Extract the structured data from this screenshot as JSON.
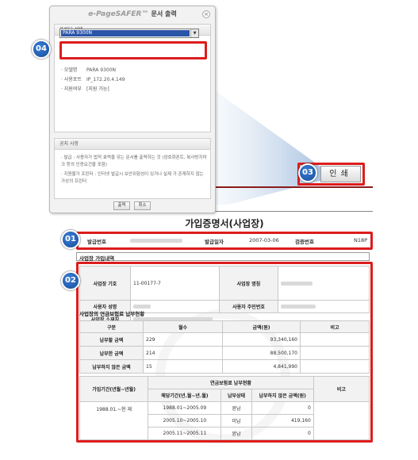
{
  "dialog": {
    "brand": "e-PageSAFER™",
    "title": "문서 출력",
    "close": "×",
    "printer_section": "프린터 선택",
    "printer_selected": "PARA 9300N",
    "info": [
      {
        "key": "· 모델명",
        "value": "PARA 9300N"
      },
      {
        "key": "· 사용포트",
        "value": "IP_172.20.4.149"
      },
      {
        "key": "· 지원여부",
        "value": "[지원 가능]"
      }
    ],
    "notice_section": "공지 사항",
    "notice_1": "· 발급 : 사용자가 법적 효력을 갖는 문서를 출력하는 것 (암호화폰트, 복사방지마크 등의 인증요건을 포함)",
    "notice_2": "· 지원불가 프린터 : 인터넷 발급시 보안위험성이 있거나 실제 가 존재하지 않는 가상의 프린터",
    "ok_button": "출력",
    "cancel_button": "취소"
  },
  "print_button": "인쇄",
  "badges": {
    "b1": "01",
    "b2": "02",
    "b3": "03",
    "b4": "04"
  },
  "document": {
    "title": "가입증명서(사업장)",
    "meta": {
      "issue_no_label": "발급번호",
      "issue_date_label": "발급일자",
      "issue_date": "2007-03-06",
      "verify_no_label": "검증번호",
      "verify_no": "N18P"
    },
    "section_membership": "사업장 가입내역",
    "membership": {
      "code_label": "사업장 기호",
      "code_value": "11-00177-7",
      "name_label": "사업장 명칭",
      "owner_label": "사용자 성명",
      "owner_id_label": "사용자 주민번호",
      "address_label": "사업장 소재지"
    },
    "section_payment": "사업장의 연금보험료 납부현황",
    "payment_headers": [
      "구분",
      "월수",
      "금액(원)",
      "비고"
    ],
    "payment_rows": [
      {
        "label": "납부할 금액",
        "months": "229",
        "amount": "93,340,160",
        "note": ""
      },
      {
        "label": "납부한 금액",
        "months": "214",
        "amount": "88,500,170",
        "note": ""
      },
      {
        "label": "납부하지 않은 금액",
        "months": "15",
        "amount": "4,841,990",
        "note": ""
      }
    ],
    "period_table": {
      "join_period_header": "가입기간(년월~년월)",
      "group_header": "연금보험료 납부현황",
      "col_period": "해당기간(년.월~년.월)",
      "col_status": "납부상태",
      "col_unpaid": "납부하지 않은 금액(원)",
      "col_note": "비고",
      "join_period": "1988.01.~현 재",
      "rows": [
        {
          "period": "1988.01~2005.09",
          "status": "완납",
          "unpaid": "0"
        },
        {
          "period": "2005.10~2005.10",
          "status": "미납",
          "unpaid": "419,160"
        },
        {
          "period": "2005.11~2005.11",
          "status": "완납",
          "unpaid": "0"
        }
      ]
    }
  },
  "colors": {
    "highlight": "#dd1c1c",
    "badge": "#1f5fb4",
    "selection": "#2a54a8"
  }
}
